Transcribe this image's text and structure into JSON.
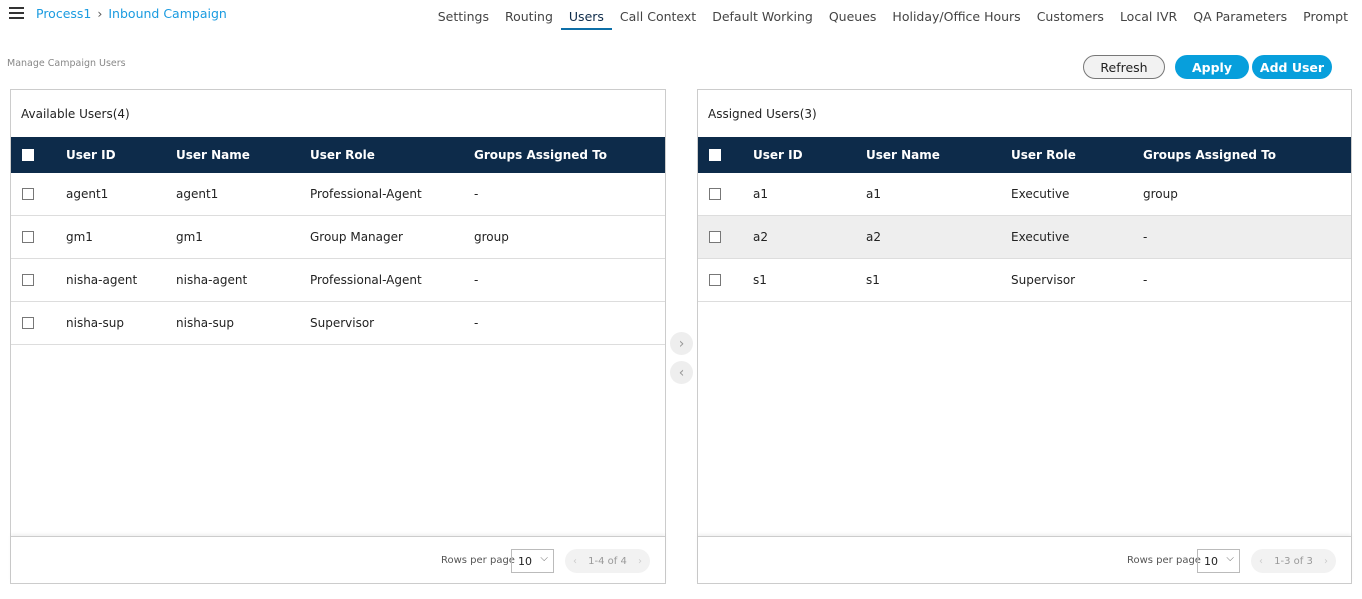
{
  "breadcrumb": {
    "items": [
      "Process1",
      "Inbound Campaign"
    ]
  },
  "nav": {
    "tabs": [
      "Settings",
      "Routing",
      "Users",
      "Call Context",
      "Default Working",
      "Queues",
      "Holiday/Office Hours",
      "Customers",
      "Local IVR",
      "QA Parameters",
      "Prompt"
    ],
    "active": "Users"
  },
  "subtitle": "Manage Campaign Users",
  "toolbar": {
    "refresh": "Refresh",
    "apply": "Apply",
    "add_user": "Add User"
  },
  "columns": [
    "User ID",
    "User Name",
    "User Role",
    "Groups Assigned To"
  ],
  "available": {
    "title": "Available Users(4)",
    "rows": [
      {
        "id": "agent1",
        "name": "agent1",
        "role": "Professional-Agent",
        "groups": "-"
      },
      {
        "id": "gm1",
        "name": "gm1",
        "role": "Group Manager",
        "groups": "group"
      },
      {
        "id": "nisha-agent",
        "name": "nisha-agent",
        "role": "Professional-Agent",
        "groups": "-"
      },
      {
        "id": "nisha-sup",
        "name": "nisha-sup",
        "role": "Supervisor",
        "groups": "-"
      }
    ],
    "rows_per_page_label": "Rows per page",
    "rows_per_page": "10",
    "range": "1-4 of 4"
  },
  "assigned": {
    "title": "Assigned Users(3)",
    "rows": [
      {
        "id": "a1",
        "name": "a1",
        "role": "Executive",
        "groups": "group"
      },
      {
        "id": "a2",
        "name": "a2",
        "role": "Executive",
        "groups": "-"
      },
      {
        "id": "s1",
        "name": "s1",
        "role": "Supervisor",
        "groups": "-"
      }
    ],
    "rows_per_page_label": "Rows per page",
    "rows_per_page": "10",
    "range": "1-3 of 3"
  },
  "colors": {
    "accent": "#079fdc",
    "header": "#0d2b4a"
  }
}
